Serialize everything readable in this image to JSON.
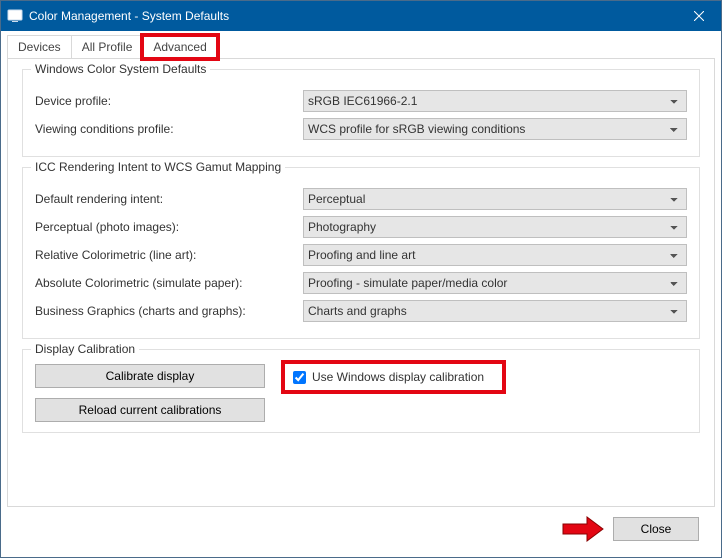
{
  "window": {
    "title": "Color Management - System Defaults"
  },
  "tabs": {
    "devices": "Devices",
    "all_profiles": "All Profile",
    "advanced": "Advanced"
  },
  "group_wcs": {
    "title": "Windows Color System Defaults",
    "device_profile_label": "Device profile:",
    "device_profile_value": "sRGB IEC61966-2.1",
    "viewing_cond_label": "Viewing conditions profile:",
    "viewing_cond_value": "WCS profile for sRGB viewing conditions"
  },
  "group_icc": {
    "title": "ICC Rendering Intent to WCS Gamut Mapping",
    "default_intent_label": "Default rendering intent:",
    "default_intent_value": "Perceptual",
    "perceptual_label": "Perceptual (photo images):",
    "perceptual_value": "Photography",
    "relative_label": "Relative Colorimetric (line art):",
    "relative_value": "Proofing and line art",
    "absolute_label": "Absolute Colorimetric (simulate paper):",
    "absolute_value": "Proofing - simulate paper/media color",
    "business_label": "Business Graphics (charts and graphs):",
    "business_value": "Charts and graphs"
  },
  "group_calib": {
    "title": "Display Calibration",
    "calibrate_btn": "Calibrate display",
    "reload_btn": "Reload current calibrations",
    "checkbox_label": "Use Windows display calibration",
    "checkbox_checked": true
  },
  "footer": {
    "close": "Close"
  }
}
